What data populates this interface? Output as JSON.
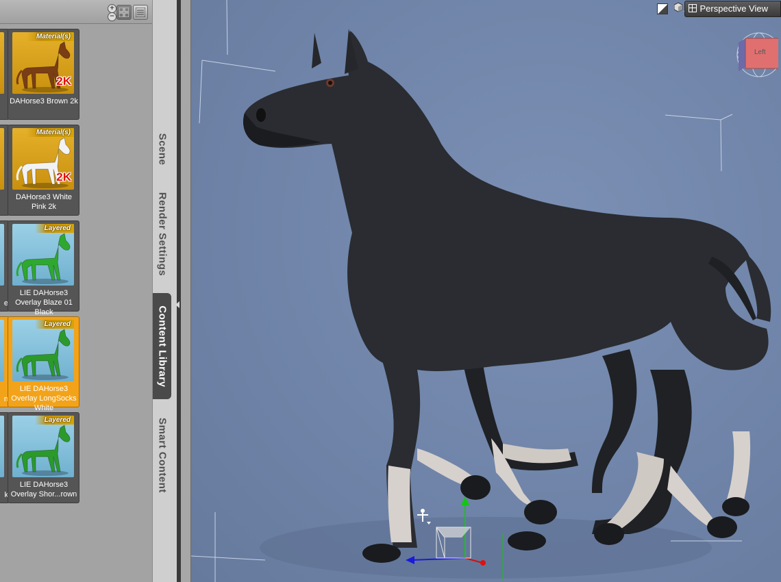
{
  "library": {
    "toolbar": {
      "zoom_in": "+",
      "zoom_out": "−"
    },
    "tiles": [
      {
        "badge": "Material(s)",
        "resolution": "2K",
        "name": "DAHorse3 Brown 2k",
        "kind": "material",
        "horse_color": "#7a3d14"
      },
      {
        "badge": "Material(s)",
        "resolution": "2K",
        "name": "DAHorse3 White Pink 2k",
        "kind": "material",
        "horse_color": "#f2f2f2"
      },
      {
        "badge": "Layered",
        "resolution": "",
        "name": "LIE DAHorse3 Overlay Blaze 01 Black",
        "kind": "layered",
        "horse_color": "#2fa82f"
      },
      {
        "badge": "Layered",
        "resolution": "",
        "name": "LIE DAHorse3 Overlay LongSocks White",
        "kind": "layered",
        "horse_color": "#2b9a2b",
        "selected": true
      },
      {
        "badge": "Layered",
        "resolution": "",
        "name": "LIE DAHorse3 Overlay Shor...rown",
        "kind": "layered",
        "horse_color": "#2b9a2b"
      }
    ],
    "partial_tile_captions": [
      "",
      "",
      "e",
      "n",
      "k"
    ]
  },
  "pane_tabs": [
    {
      "label": "Scene",
      "active": false
    },
    {
      "label": "Render Settings",
      "active": false
    },
    {
      "label": "Content Library",
      "active": true
    },
    {
      "label": "Smart Content",
      "active": false
    }
  ],
  "viewport": {
    "view_label": "Perspective View",
    "view_cube_label": "Left",
    "icons": [
      "draw-style-icon",
      "cube-icon",
      "grid-icon",
      "chevron-down-icon"
    ],
    "colors": {
      "background": "#7086aa",
      "horse_coat": "#27292d",
      "horse_socks": "#d6d0cc",
      "gizmo_y": "#15c515",
      "gizmo_x": "#d01010",
      "gizmo_z": "#1010d0"
    }
  }
}
